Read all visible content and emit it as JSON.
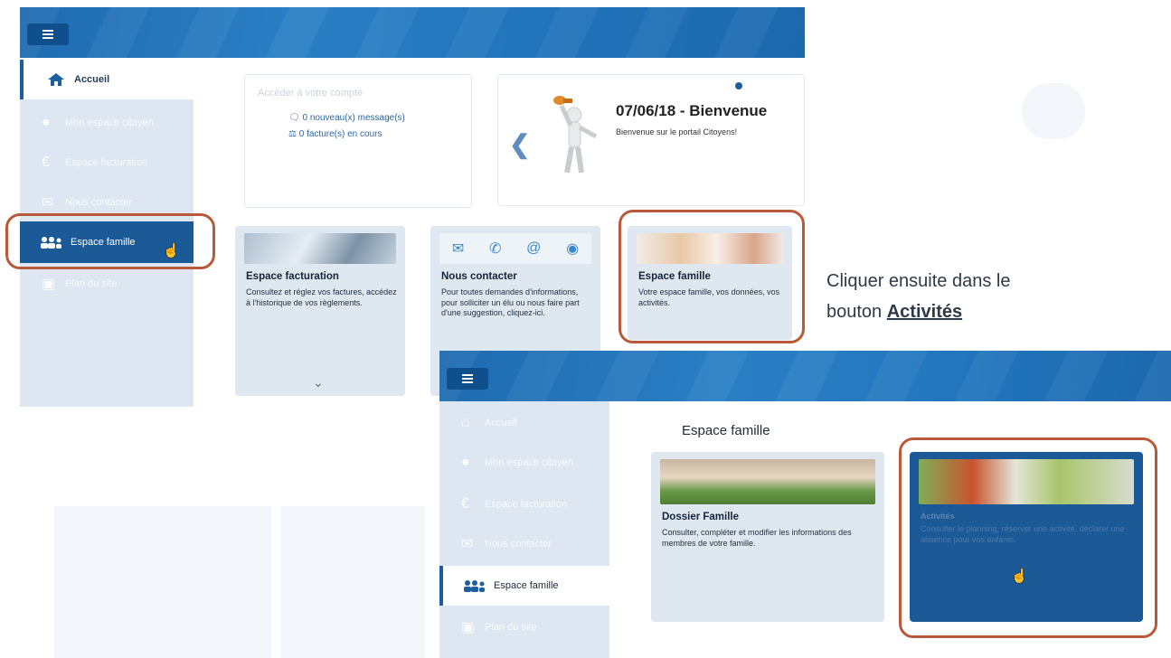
{
  "screen1": {
    "menu_icon": "hamburger-icon",
    "sidebar": {
      "active_label": "Accueil",
      "items": [
        {
          "label": "Mon espace citoyen",
          "icon": "user-icon"
        },
        {
          "label": "Espace facturation",
          "icon": "euro-icon"
        },
        {
          "label": "Nous contacter",
          "icon": "envelope-icon"
        },
        {
          "label": "Espace famille",
          "icon": "family-icon"
        },
        {
          "label": "Plan du site",
          "icon": "sitemap-icon"
        }
      ]
    },
    "account_box": {
      "title": "Accéder à votre compte",
      "messages": "0 nouveau(x) message(s)",
      "invoices": "0 facture(s) en cours"
    },
    "carousel": {
      "title": "07/06/18 - Bienvenue",
      "subtitle": "Bienvenue sur le portail Citoyens!"
    },
    "cards": [
      {
        "title": "Espace facturation",
        "text": "Consultez et réglez vos factures, accédez à l'historique de vos règlements."
      },
      {
        "title": "Nous contacter",
        "text": "Pour toutes demandes d'informations, pour solliciter un élu ou nous faire part d'une suggestion, cliquez-ici."
      },
      {
        "title": "Espace famille",
        "text": "Votre espace famille, vos données, vos activités."
      }
    ]
  },
  "instruction": {
    "line1": "Cliquer ensuite dans le",
    "line2_prefix": "bouton ",
    "line2_bold": "Activités"
  },
  "screen2": {
    "sidebar": {
      "items": [
        {
          "label": "Accueil",
          "icon": "home-icon"
        },
        {
          "label": "Mon espace citoyen",
          "icon": "user-icon"
        },
        {
          "label": "Espace facturation",
          "icon": "euro-icon"
        },
        {
          "label": "Nous contacter",
          "icon": "envelope-icon"
        },
        {
          "label": "Plan du site",
          "icon": "sitemap-icon"
        }
      ],
      "active_label": "Espace famille"
    },
    "heading": "Espace famille",
    "cards": [
      {
        "title": "Dossier Famille",
        "text": "Consulter, compléter et modifier les informations des membres de votre famille."
      },
      {
        "title": "Activités",
        "text": "Consulter le planning, réserver une activité, déclarer une absence pour vos enfants."
      }
    ]
  },
  "colors": {
    "topbar": "#2276bd",
    "menu_button": "#0f4f8c",
    "sidebar_bg": "#dde6f1",
    "selected_item": "#1c5a97",
    "highlight_frame": "#b85a3a"
  }
}
